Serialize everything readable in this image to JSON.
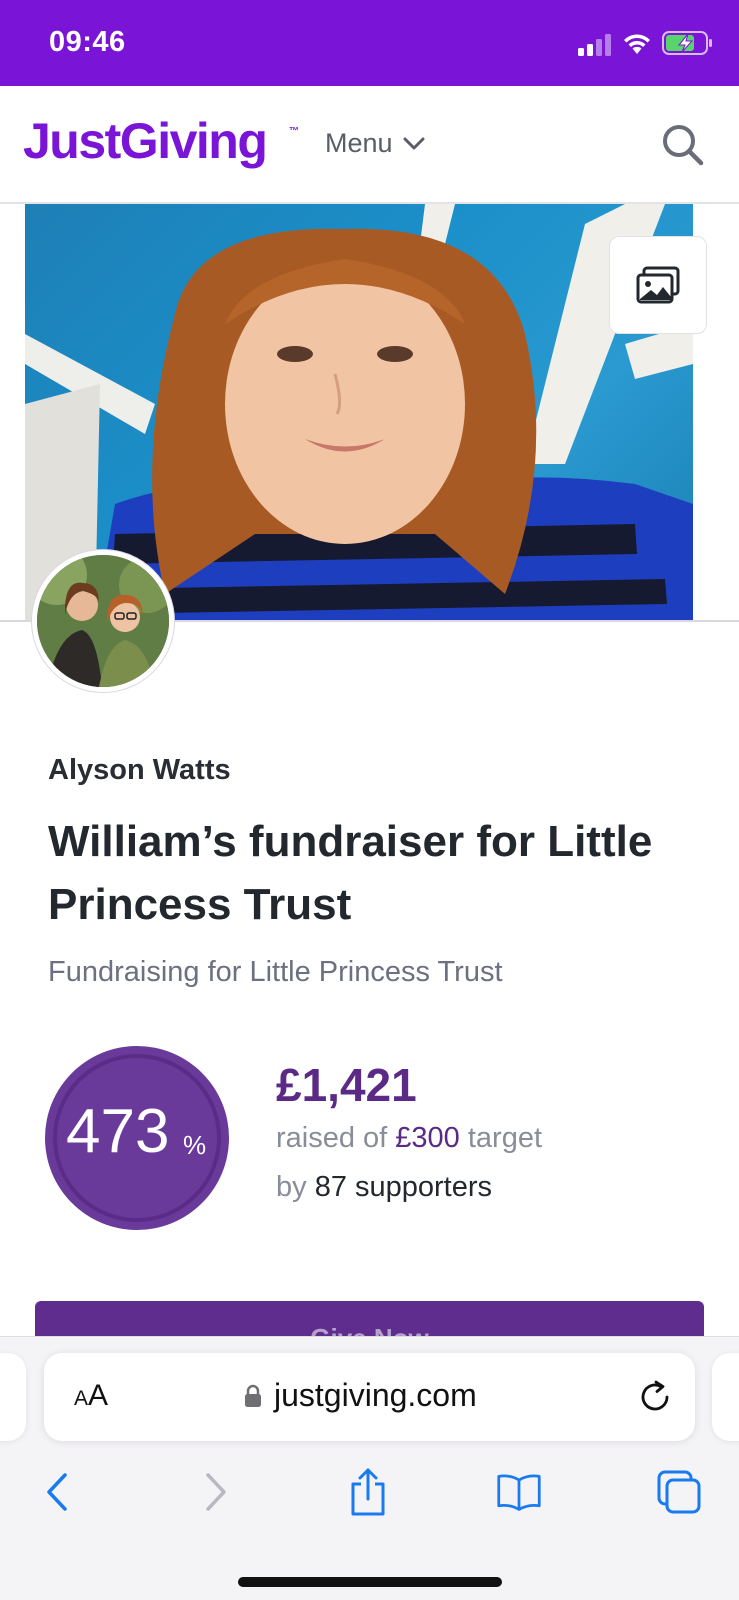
{
  "status_bar": {
    "time": "09:46"
  },
  "header": {
    "logo": "JustGiving",
    "logo_tm": "™",
    "menu_label": "Menu"
  },
  "page": {
    "owner_name": "Alyson Watts",
    "title": "William’s fundraiser for Little Princess Trust",
    "subtitle": "Fundraising for Little Princess Trust",
    "progress": {
      "percent_value": "473",
      "percent_sign": "%",
      "percent_fraction": 4.73
    },
    "raised_amount": "£1,421",
    "raised_prefix": "raised of ",
    "target_amount": "£300",
    "target_suffix": " target",
    "by_prefix": "by ",
    "supporters": "87 supporters",
    "cta_label": "Give Now"
  },
  "browser": {
    "aa_large": "A",
    "aa_small": "A",
    "url": "justgiving.com"
  },
  "colors": {
    "status_bar": "#7a14d6",
    "brand_purple": "#7a14d6",
    "accent_purple": "#5b2a87",
    "ios_blue": "#1a7bf0"
  },
  "icons": {
    "gallery": "gallery-icon",
    "search": "search-icon",
    "menu_chevron": "chevron-down-icon",
    "lock": "lock-icon",
    "reload": "reload-icon",
    "back": "back-arrow-icon",
    "forward": "forward-arrow-icon",
    "share": "share-icon",
    "bookmarks": "bookmarks-icon",
    "tabs": "tabs-icon"
  }
}
